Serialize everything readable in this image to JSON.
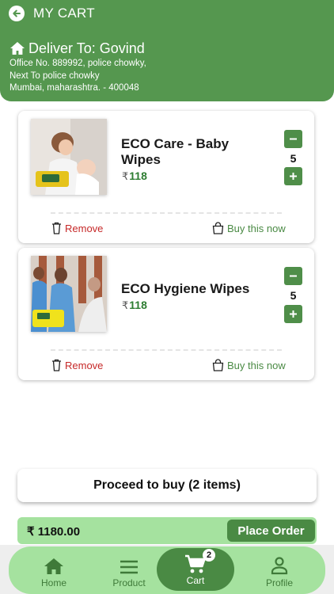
{
  "header": {
    "title": "MY CART",
    "deliver_to": "Deliver To: Govind",
    "address_lines": [
      "Office No. 889992, police chowky,",
      "Next To police chowky",
      "Mumbai, maharashtra. - 400048"
    ]
  },
  "items": [
    {
      "name": "ECO Care - Baby Wipes",
      "currency": "₹",
      "price": "118",
      "quantity": "5",
      "remove_label": "Remove",
      "buy_label": "Buy this now"
    },
    {
      "name": "ECO Hygiene Wipes",
      "currency": "₹",
      "price": "118",
      "quantity": "5",
      "remove_label": "Remove",
      "buy_label": "Buy this now"
    }
  ],
  "proceed_label": "Proceed to buy (2 items)",
  "order_bar": {
    "total": "₹ 1180.00",
    "place_order_label": "Place Order"
  },
  "nav": {
    "items": [
      {
        "label": "Home",
        "icon": "home-icon"
      },
      {
        "label": "Product",
        "icon": "menu-icon"
      },
      {
        "label": "Cart",
        "icon": "cart-icon"
      },
      {
        "label": "Profile",
        "icon": "person-icon"
      }
    ],
    "cart_badge": "2"
  },
  "colors": {
    "primary": "#55974f",
    "accent_dark": "#4a8a44",
    "accent_light": "#a5e29f",
    "remove": "#c62828",
    "price": "#2e7d32"
  }
}
